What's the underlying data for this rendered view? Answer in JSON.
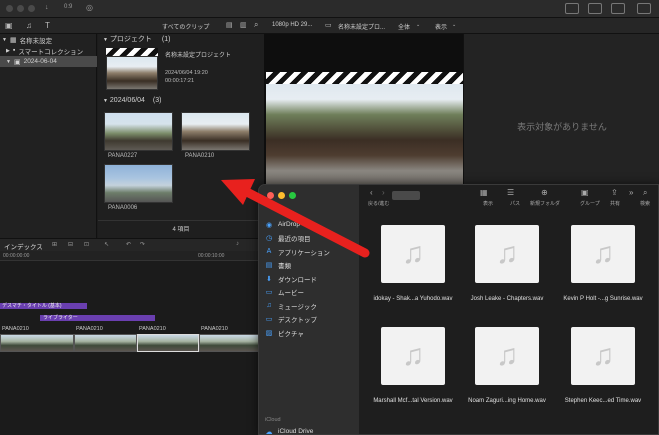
{
  "window": {
    "timecode": "0:9"
  },
  "toolbar": {
    "clip_filter": "すべてのクリップ",
    "viewer_format": "1080p HD 29...",
    "viewer_project": "名称未設定プロ...",
    "view_all": "全体",
    "display": "表示"
  },
  "sidebar": {
    "library": "名称未設定",
    "items": [
      {
        "label": "スマートコレクション"
      },
      {
        "label": "2024-06-04"
      }
    ]
  },
  "browser": {
    "projects_header": "プロジェクト",
    "projects_count": "(1)",
    "project": {
      "name": "名称未設定プロジェクト",
      "date": "2024/06/04 19:20",
      "duration": "00:00:17:21"
    },
    "event_header": "2024/06/04",
    "event_count": "(3)",
    "clips": [
      {
        "label": "PANA0227"
      },
      {
        "label": "PANA0210"
      },
      {
        "label": "PANA0006"
      }
    ],
    "footer": "4 項目"
  },
  "inspector": {
    "empty_text": "表示対象がありません"
  },
  "timeline": {
    "index_tab": "インデックス",
    "time_start": "00:00:00:00",
    "time_mark": "00:00:10:00",
    "title_bar": "デスマチ・タイトル (基本)",
    "lower_third": "ライブライター",
    "clips": [
      "PANA0210",
      "PANA0210",
      "PANA0210",
      "PANA0210"
    ]
  },
  "finder": {
    "back_label": "戻る/進む",
    "toolbar": [
      {
        "label": "表示"
      },
      {
        "label": "パス"
      },
      {
        "label": "新規フォルダ"
      },
      {
        "label": "グループ"
      },
      {
        "label": "共有"
      },
      {
        "label": "検索"
      }
    ],
    "sidebar": [
      {
        "label": "AirDrop",
        "icon": "airdrop-icon"
      },
      {
        "label": "最近の項目",
        "icon": "clock-icon"
      },
      {
        "label": "アプリケーション",
        "icon": "apps-icon"
      },
      {
        "label": "書類",
        "icon": "document-icon"
      },
      {
        "label": "ダウンロード",
        "icon": "download-icon"
      },
      {
        "label": "ムービー",
        "icon": "movie-icon"
      },
      {
        "label": "ミュージック",
        "icon": "music-icon"
      },
      {
        "label": "デスクトップ",
        "icon": "desktop-icon"
      },
      {
        "label": "ピクチャ",
        "icon": "picture-icon"
      }
    ],
    "icloud_header": "iCloud",
    "icloud_drive": "iCloud Drive",
    "files": [
      {
        "name": "idokay - Shak...a Yuhodo.wav"
      },
      {
        "name": "Josh Leake - Chapters.wav"
      },
      {
        "name": "Kevin P Holt -...g Sunrise.wav"
      },
      {
        "name": "Marshall Mcf...tal Version.wav"
      },
      {
        "name": "Noam Zaguri...ing Home.wav"
      },
      {
        "name": "Stephen Keec...ed Time.wav"
      }
    ]
  },
  "colors": {
    "accent": "#4aa3ff",
    "arrow": "#e8211e",
    "purple": "#6a3fb0"
  }
}
